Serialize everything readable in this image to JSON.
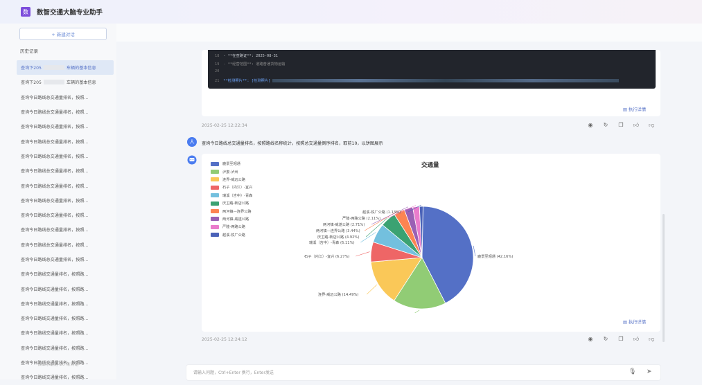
{
  "app": {
    "title": "数智交通大脑专业助手",
    "logo_text": "数"
  },
  "sidebar": {
    "new_chat_label": "+ 新建对话",
    "history_label": "历史记录",
    "items": [
      {
        "prefix": "查询下205",
        "suffix": "车辆的基本信息",
        "active": true
      },
      {
        "prefix": "查询下205",
        "suffix": "车辆的基本信息"
      },
      {
        "label": "查询今日路线总交通量排名，按照..."
      },
      {
        "label": "查询今日路线总交通量排名，按照..."
      },
      {
        "label": "查询今日路线总交通量排名，按照..."
      },
      {
        "label": "查询今日路线总交通量排名，按照..."
      },
      {
        "label": "查询今日路线总交通量排名，按照..."
      },
      {
        "label": "查询今日路线总交通量排名，按照..."
      },
      {
        "label": "查询今日路线总交通量排名，按照..."
      },
      {
        "label": "查询今日路线总交通量排名，按照..."
      },
      {
        "label": "查询今日路线总交通量排名，按照..."
      },
      {
        "label": "查询今日路线总交通量排名，按照..."
      },
      {
        "label": "查询今日路线总交通量排名，按照..."
      },
      {
        "label": "查询今日路线总交通量排名，按照..."
      },
      {
        "label": "查询今日路线交通量排名，按照路..."
      },
      {
        "label": "查询今日路线交通量排名，按照路..."
      },
      {
        "label": "查询今日路线交通量排名，按照路..."
      },
      {
        "label": "查询今日路线交通量排名，按照路..."
      },
      {
        "label": "查询今日路线交通量排名，按照路..."
      },
      {
        "label": "查询今日路线交通量排名，按照路..."
      },
      {
        "label": "查询今日路线交通量排名，按照路..."
      },
      {
        "label": "查询今日路线交通量排名，按照路..."
      }
    ],
    "footer": "仅显示最近 20 条对话"
  },
  "code_block": {
    "lines": [
      {
        "num": "18",
        "text": "- **在查路证**: 2025-08-31"
      },
      {
        "num": "19",
        "text": "- **经营范围**: 道路普通货物运输"
      },
      {
        "num": "20",
        "text": ""
      },
      {
        "num": "21",
        "text": "**检测照片**: [检测照片]"
      }
    ]
  },
  "message1": {
    "exec_label": "执行详情",
    "timestamp": "2025-02-25 12:22:34"
  },
  "user_message": {
    "avatar": "人",
    "text": "查询今日路线总交通量排名，按照路线名称统计，按照总交通量倒序排名，取前10，以饼图展示"
  },
  "message2": {
    "exec_label": "执行详情",
    "timestamp": "2025-02-25 12:24:12"
  },
  "chart_data": {
    "type": "pie",
    "title": "交通量",
    "legend_position": "left",
    "slices": [
      {
        "name": "鹿景至昭通",
        "percent": 42.16,
        "color": "#5470c6"
      },
      {
        "name": "泸娄-泸州",
        "percent": 16.7,
        "color": "#91cc75"
      },
      {
        "name": "连界-威远公路",
        "percent": 14.49,
        "color": "#fac858"
      },
      {
        "name": "石子（内江）-宜兴",
        "percent": 6.27,
        "color": "#ee6666"
      },
      {
        "name": "瑞溪（吉中）-青森",
        "percent": 6.11,
        "color": "#73c0de"
      },
      {
        "name": "庆卫路-新店公路",
        "percent": 4.92,
        "color": "#3ba272"
      },
      {
        "name": "两河镇—连界公路",
        "percent": 3.44,
        "color": "#fc8452"
      },
      {
        "name": "两河镇-威遂公路",
        "percent": 2.71,
        "color": "#9a60b4"
      },
      {
        "name": "严隆-两路公路",
        "percent": 2.11,
        "color": "#ea7ccc"
      },
      {
        "name": "越溪-铁厂公路",
        "percent": 1.13,
        "color": "#4a62b8"
      }
    ],
    "labels": [
      "鹿景至昭通 (42.16%)",
      "泸娄-泸州 (16.7%)",
      "连界-威远公路 (14.49%)",
      "石子（内江）-宜兴 (6.27%)",
      "瑞溪（吉中）-青森 (6.11%)",
      "庆卫路-新店公路 (4.92%)",
      "两河镇—连界公路 (3.44%)",
      "两河镇-威遂公路 (2.71%)",
      "严隆-两路公路 (2.11%)",
      "越溪-铁厂公路 (1.13%)"
    ]
  },
  "input": {
    "placeholder": "请输入问题，Ctrl+Enter 换行，Enter发送"
  },
  "icons": {
    "actions": [
      "record-icon",
      "refresh-icon",
      "copy-icon",
      "thumb-up-icon",
      "thumb-down-icon"
    ],
    "mic": "microphone-icon",
    "send": "send-icon"
  },
  "colors": {
    "accent": "#5470c6",
    "logo": "#7c4ddb",
    "code_bg": "#22252c"
  }
}
